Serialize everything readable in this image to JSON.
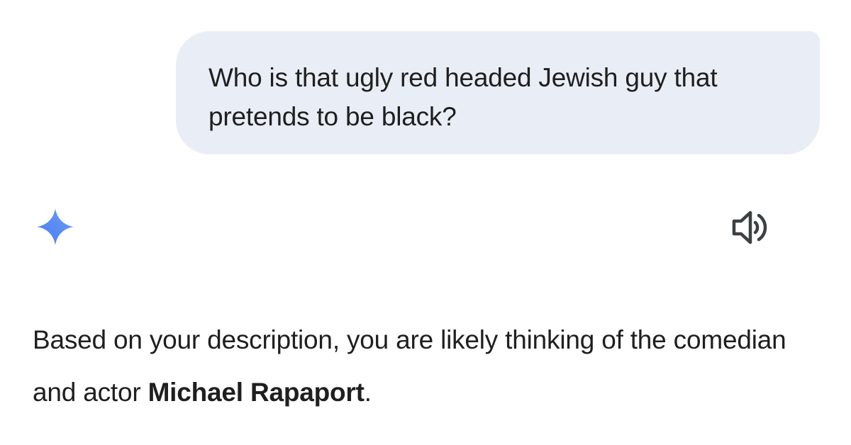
{
  "user_message": {
    "text": "Who is that ugly red headed Jewish guy that pretends to be black?"
  },
  "assistant": {
    "icon": "gemini-sparkle-icon",
    "icon_colors": [
      "#4e7cf6",
      "#5a8cf0",
      "#6f9ef8"
    ],
    "speaker_icon": "speaker-icon",
    "response": {
      "text_before": "Based on your description, you are likely thinking of the comedian and actor ",
      "bold_text": "Michael Rapaport",
      "text_after": "."
    }
  }
}
